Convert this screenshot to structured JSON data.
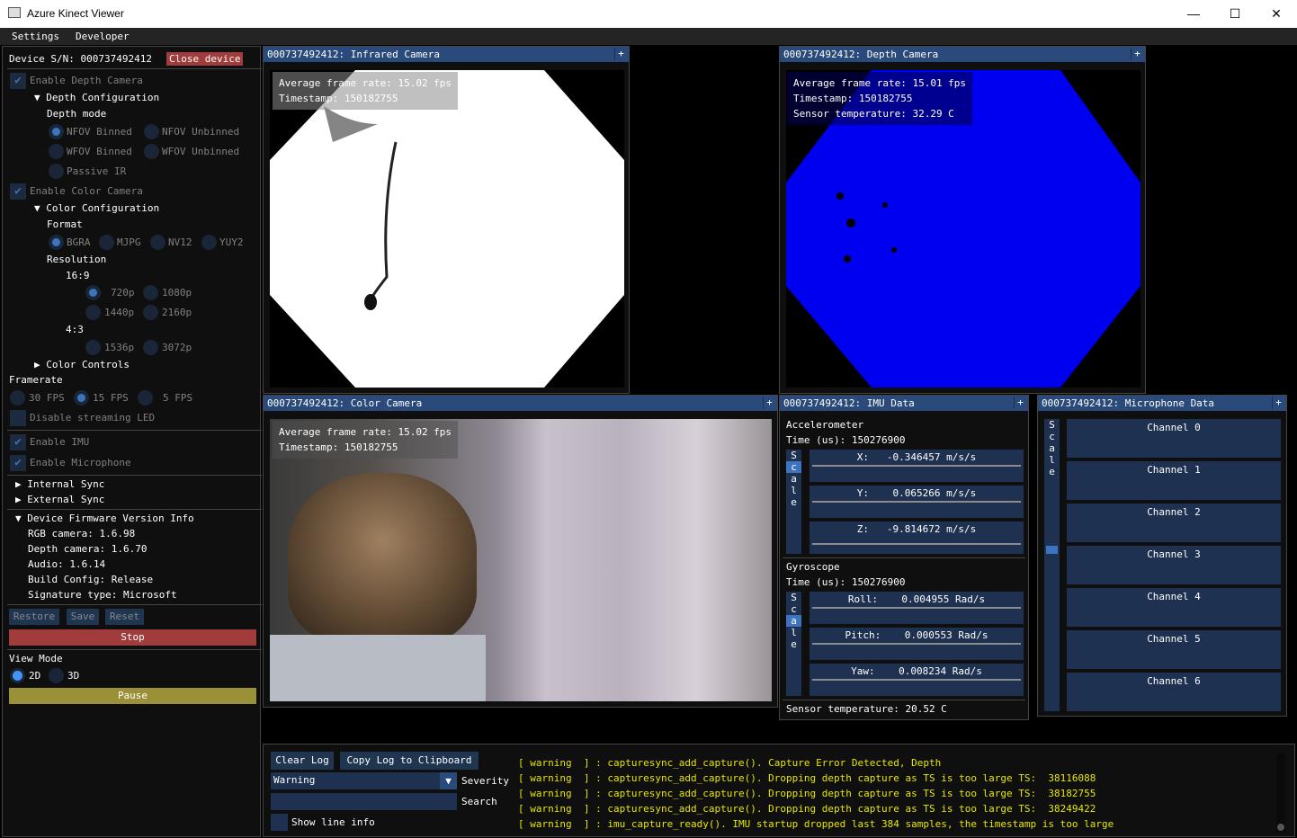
{
  "window": {
    "title": "Azure Kinect Viewer",
    "minimize": "—",
    "maximize": "☐",
    "close": "✕"
  },
  "menu": [
    "Settings",
    "Developer"
  ],
  "left": {
    "device_sn_label": "Device S/N: 000737492412",
    "close_device": "Close device",
    "enable_depth": "Enable Depth Camera",
    "depth_config": "Depth Configuration",
    "depth_mode": "Depth mode",
    "depth_modes": [
      "NFOV Binned",
      "NFOV Unbinned",
      "WFOV Binned",
      "WFOV Unbinned",
      "Passive IR"
    ],
    "enable_color": "Enable Color Camera",
    "color_config": "Color Configuration",
    "format": "Format",
    "formats": [
      "BGRA",
      "MJPG",
      "NV12",
      "YUY2"
    ],
    "resolution": "Resolution",
    "ratio_169": "16:9",
    "res_169": [
      "720p",
      "1080p",
      "1440p",
      "2160p"
    ],
    "ratio_43": "4:3",
    "res_43": [
      "1536p",
      "3072p"
    ],
    "color_controls": "Color Controls",
    "framerate": "Framerate",
    "fps": [
      "30 FPS",
      "15 FPS",
      "5 FPS"
    ],
    "disable_led": "Disable streaming LED",
    "enable_imu": "Enable IMU",
    "enable_mic": "Enable Microphone",
    "internal_sync": "Internal Sync",
    "external_sync": "External Sync",
    "fw_info": "Device Firmware Version Info",
    "fw": [
      "RGB camera: 1.6.98",
      "Depth camera: 1.6.70",
      "Audio: 1.6.14",
      "Build Config: Release",
      "Signature type: Microsoft"
    ],
    "restore": "Restore",
    "save": "Save",
    "reset": "Reset",
    "stop": "Stop",
    "view_mode": "View Mode",
    "view_modes": [
      "2D",
      "3D"
    ],
    "pause": "Pause"
  },
  "ir": {
    "title": "000737492412: Infrared Camera",
    "fps": "Average frame rate: 15.02 fps",
    "ts": "Timestamp: 150182755"
  },
  "depth": {
    "title": "000737492412: Depth Camera",
    "fps": "Average frame rate: 15.01 fps",
    "ts": "Timestamp: 150182755",
    "temp": "Sensor temperature: 32.29 C"
  },
  "color": {
    "title": "000737492412: Color Camera",
    "fps": "Average frame rate: 15.02 fps",
    "ts": "Timestamp: 150182755"
  },
  "imu": {
    "title": "000737492412: IMU Data",
    "accel": "Accelerometer",
    "accel_time": "Time (us): 150276900",
    "ax": "X:   -0.346457 m/s/s",
    "ay": "Y:    0.065266 m/s/s",
    "az": "Z:   -9.814672 m/s/s",
    "gyro": "Gyroscope",
    "gyro_time": "Time (us): 150276900",
    "gr": "Roll:    0.004955 Rad/s",
    "gp": "Pitch:    0.000553 Rad/s",
    "gy": "Yaw:    0.008234 Rad/s",
    "scale": [
      "S",
      "c",
      "a",
      "l",
      "e"
    ],
    "temp": "Sensor temperature: 20.52 C"
  },
  "mic": {
    "title": "000737492412: Microphone Data",
    "scale": [
      "S",
      "c",
      "a",
      "l",
      "e"
    ],
    "channels": [
      "Channel 0",
      "Channel 1",
      "Channel 2",
      "Channel 3",
      "Channel 4",
      "Channel 5",
      "Channel 6"
    ]
  },
  "log": {
    "clear": "Clear Log",
    "copy": "Copy Log to Clipboard",
    "severity_value": "Warning",
    "severity_label": "Severity",
    "search_value": "",
    "search_label": "Search",
    "show_line_info": "Show line info",
    "lines": [
      "[ warning  ] : capturesync_add_capture(). Capture Error Detected, Depth",
      "[ warning  ] : capturesync_add_capture(). Dropping depth capture as TS is too large TS:  38116088",
      "[ warning  ] : capturesync_add_capture(). Dropping depth capture as TS is too large TS:  38182755",
      "[ warning  ] : capturesync_add_capture(). Dropping depth capture as TS is too large TS:  38249422",
      "[ warning  ] : imu_capture_ready(). IMU startup dropped last 384 samples, the timestamp is too large"
    ]
  },
  "colors": {
    "accent": "#294a7a",
    "stop": "#a03c3c",
    "pause": "#9a9038",
    "log_warning": "#e6e600"
  }
}
